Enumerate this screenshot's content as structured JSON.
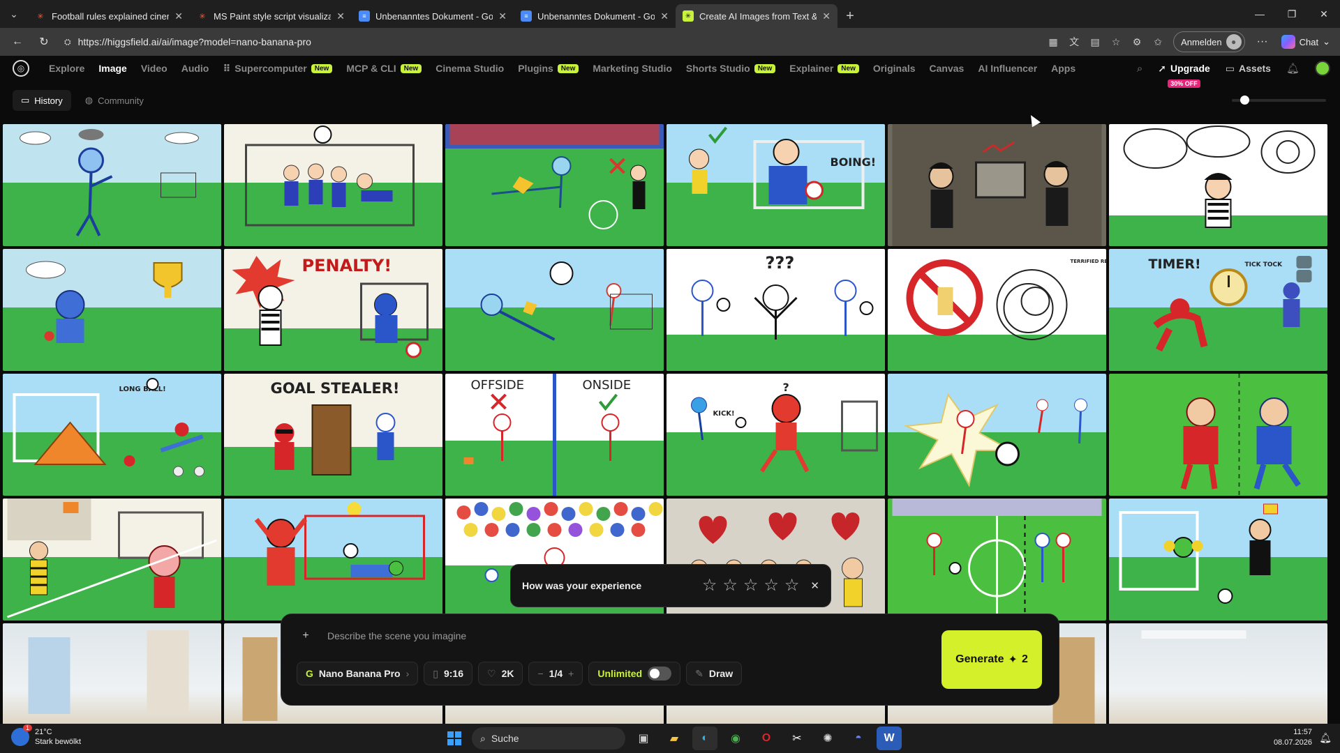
{
  "browser": {
    "tabs": [
      {
        "title": "Football rules explained cinematic",
        "icon": "higgsfield-icon"
      },
      {
        "title": "MS Paint style script visualization",
        "icon": "higgsfield-icon"
      },
      {
        "title": "Unbenanntes Dokument - Google",
        "icon": "google-docs-icon"
      },
      {
        "title": "Unbenanntes Dokument - Google",
        "icon": "google-docs-icon"
      },
      {
        "title": "Create AI Images from Text & Pho",
        "icon": "higgsfield-icon",
        "active": true
      }
    ],
    "url": "https://higgsfield.ai/ai/image?model=nano-banana-pro",
    "signin_label": "Anmelden",
    "chat_label": "Chat"
  },
  "nav": {
    "items": [
      {
        "label": "Explore"
      },
      {
        "label": "Image",
        "active": true
      },
      {
        "label": "Video"
      },
      {
        "label": "Audio"
      },
      {
        "label": "Supercomputer",
        "badge": "New"
      },
      {
        "label": "MCP & CLI",
        "badge": "New"
      },
      {
        "label": "Cinema Studio"
      },
      {
        "label": "Plugins",
        "badge": "New"
      },
      {
        "label": "Marketing Studio"
      },
      {
        "label": "Shorts Studio",
        "badge": "New"
      },
      {
        "label": "Explainer",
        "badge": "New"
      },
      {
        "label": "Originals"
      },
      {
        "label": "Canvas"
      },
      {
        "label": "AI Influencer"
      },
      {
        "label": "Apps"
      }
    ],
    "upgrade_label": "Upgrade",
    "upgrade_badge": "30% OFF",
    "assets_label": "Assets"
  },
  "subtabs": {
    "history": "History",
    "community": "Community"
  },
  "zoom_level": 0.1,
  "gallery": {
    "captions": {
      "boing": "BOING!",
      "penalty": "PENALTY!",
      "timer": "TIMER!",
      "tick_tock": "TICK TOCK",
      "terrified_ref": "TERRIFIED REF",
      "long_ball": "LONG BALL!",
      "goal_stealer": "GOAL STEALER!",
      "offside": "OFFSIDE",
      "onside": "ONSIDE",
      "kick": "KICK!"
    }
  },
  "rating": {
    "question": "How was your experience",
    "star_count": 5
  },
  "prompt": {
    "placeholder": "Describe the scene you imagine",
    "model": "Nano Banana Pro",
    "aspect": "9:16",
    "resolution": "2K",
    "batch": "1/4",
    "unlimited_label": "Unlimited",
    "draw_label": "Draw",
    "generate_label": "Generate",
    "generate_cost": "2"
  },
  "taskbar": {
    "weather_temp": "21°C",
    "weather_desc": "Stark bewölkt",
    "weather_badge": "1",
    "search_label": "Suche",
    "time": "11:57",
    "date": "08.07.2026"
  }
}
